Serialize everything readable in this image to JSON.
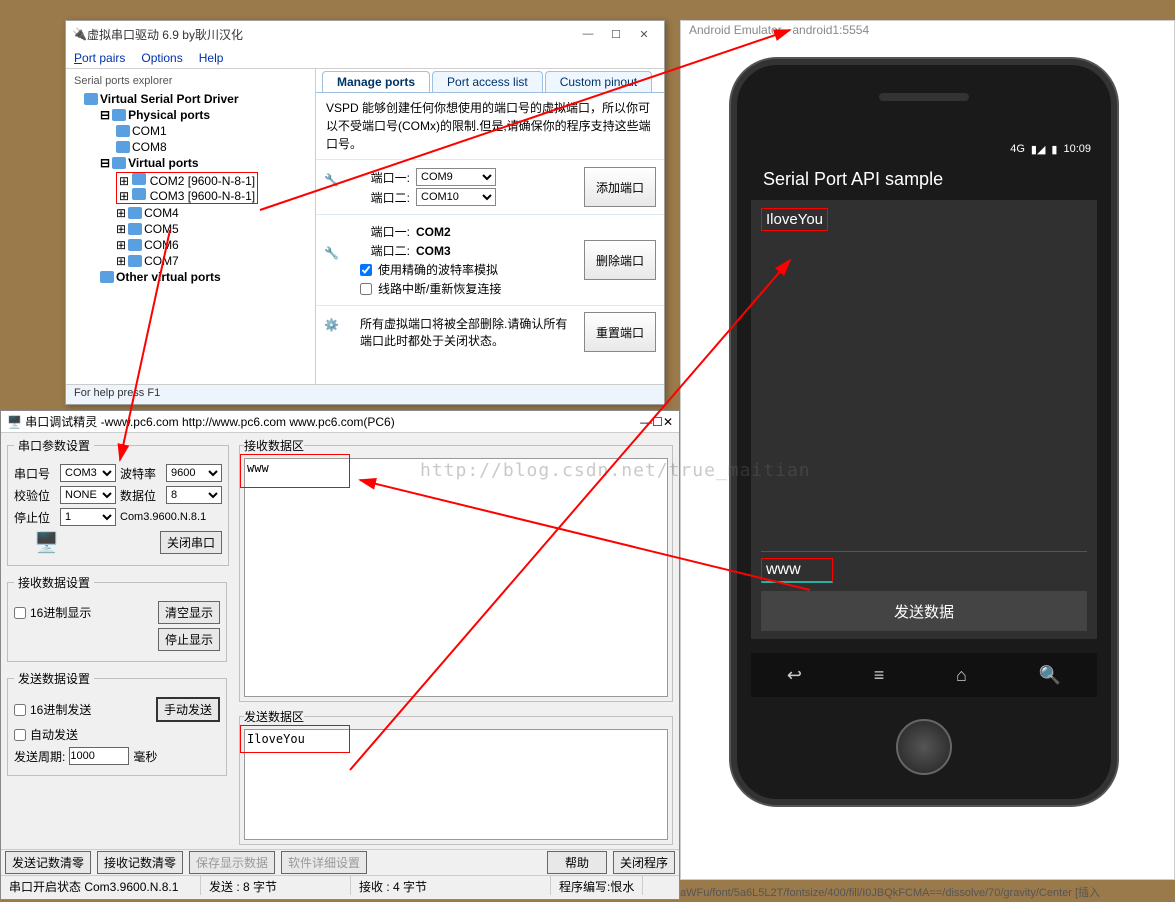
{
  "vspd": {
    "title": "虚拟串口驱动 6.9 by耿川汉化",
    "menu": {
      "portpairs": "Port pairs",
      "options": "Options",
      "help": "Help"
    },
    "explorer_title": "Serial ports explorer",
    "tree": {
      "root": "Virtual Serial Port Driver",
      "phys": "Physical ports",
      "phys_items": [
        "COM1",
        "COM8"
      ],
      "virt": "Virtual ports",
      "virt_pair": [
        "COM2 [9600-N-8-1]",
        "COM3 [9600-N-8-1]"
      ],
      "virt_rest": [
        "COM4",
        "COM5",
        "COM6",
        "COM7"
      ],
      "other": "Other virtual ports"
    },
    "tabs": {
      "manage": "Manage ports",
      "access": "Port access list",
      "custom": "Custom pinout"
    },
    "desc": "VSPD 能够创建任何你想使用的端口号的虚拟端口，所以你可以不受端口号(COMx)的限制.但是,请确保你的程序支持这些端口号。",
    "port1_label": "端口一:",
    "port2_label": "端口二:",
    "add_sel1": "COM9",
    "add_sel2": "COM10",
    "add_btn": "添加端口",
    "del_v1": "COM2",
    "del_v2": "COM3",
    "del_btn": "删除端口",
    "chk1": "使用精确的波特率模拟",
    "chk2": "线路中断/重新恢复连接",
    "reset_desc": "所有虚拟端口将被全部删除.请确认所有端口此时都处于关闭状态。",
    "reset_btn": "重置端口",
    "footer": "For help press F1"
  },
  "dbg": {
    "title": "串口调试精灵 -www.pc6.com  http://www.pc6.com     www.pc6.com(PC6)",
    "grp_param": "串口参数设置",
    "lbl_port": "串口号",
    "val_port": "COM3",
    "lbl_baud": "波特率",
    "val_baud": "9600",
    "lbl_parity": "校验位",
    "val_parity": "NONE",
    "lbl_databits": "数据位",
    "val_databits": "8",
    "lbl_stop": "停止位",
    "val_stop": "1",
    "cfg_str": "Com3.9600.N.8.1",
    "btn_close": "关闭串口",
    "grp_rx": "接收数据设置",
    "chk_hexrx": "16进制显示",
    "btn_clrdisp": "清空显示",
    "btn_stopdisp": "停止显示",
    "grp_tx": "发送数据设置",
    "chk_hextx": "16进制发送",
    "chk_auto": "自动发送",
    "btn_manual": "手动发送",
    "lbl_period": "发送周期:",
    "val_period": "1000",
    "lbl_ms": "毫秒",
    "grp_rxdata": "接收数据区",
    "rx_text": "www",
    "grp_txdata": "发送数据区",
    "tx_text": "IloveYou",
    "bb_clr_tx": "发送记数清零",
    "bb_clr_rx": "接收记数清零",
    "bb_save": "保存显示数据",
    "bb_detail": "软件详细设置",
    "bb_help": "帮助",
    "bb_quit": "关闭程序",
    "status_open": "串口开启状态  Com3.9600.N.8.1",
    "status_tx": "发送 : 8 字节",
    "status_rx": "接收 : 4 字节",
    "status_author": "程序编写:恨水"
  },
  "emu": {
    "title": "Android Emulator - android1:5554",
    "time": "10:09",
    "sig": "4G",
    "app_title": "Serial Port API sample",
    "rx": "IloveYou",
    "tx": "www",
    "send": "发送数据"
  },
  "watermark": "http://blog.csdn.net/true_maitian",
  "bottomtext": "aWFu/font/5a6L5L2T/fontsize/400/fill/I0JBQkFCMA==/dissolve/70/gravity/Center  [插入"
}
